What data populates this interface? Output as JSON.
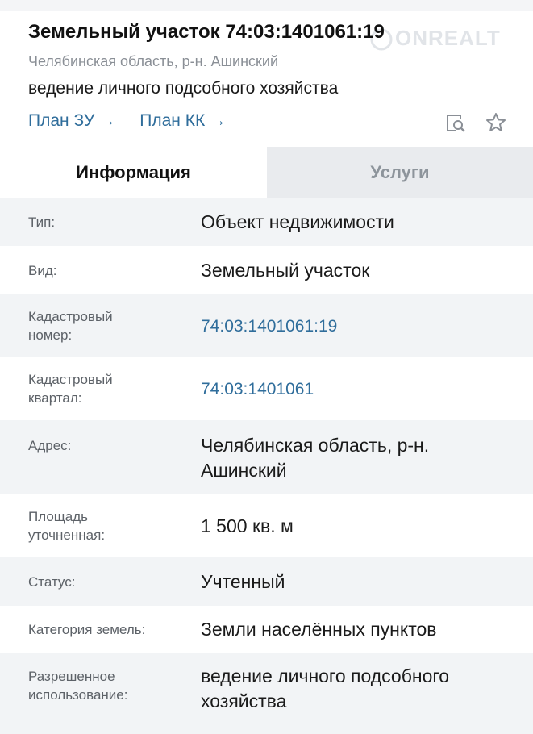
{
  "header": {
    "title": "Земельный участок 74:03:1401061:19",
    "region": "Челябинская область, р-н. Ашинский",
    "usage": "ведение личного подсобного хозяйства",
    "links": [
      {
        "label": "План ЗУ"
      },
      {
        "label": "План КК"
      }
    ],
    "watermark": "ONREALT"
  },
  "tabs": [
    {
      "label": "Информация",
      "active": true
    },
    {
      "label": "Услуги",
      "active": false
    }
  ],
  "properties": [
    {
      "label": "Тип:",
      "value": "Объект недвижимости"
    },
    {
      "label": "Вид:",
      "value": "Земельный участок"
    },
    {
      "label": "Кадастровый номер:",
      "value": "74:03:1401061:19"
    },
    {
      "label": "Кадастровый квартал:",
      "value": "74:03:1401061"
    },
    {
      "label": "Адрес:",
      "value": "Челябинская область, р-н. Ашинский"
    },
    {
      "label": "Площадь уточненная:",
      "value": "1 500 кв. м"
    },
    {
      "label": "Статус:",
      "value": "Учтенный"
    },
    {
      "label": "Категория земель:",
      "value": "Земли населённых пунктов"
    },
    {
      "label": "Разрешенное использование:",
      "value": "ведение личного подсобного хозяйства"
    }
  ],
  "icons": {
    "arrow": "arrow-right-icon",
    "search_doc": "document-search-icon",
    "star": "star-outline-icon"
  },
  "colors": {
    "link": "#2f6d9b",
    "muted": "#8a8f96",
    "row_alt": "#f2f4f6",
    "tab_inactive_bg": "#e9ebee"
  }
}
